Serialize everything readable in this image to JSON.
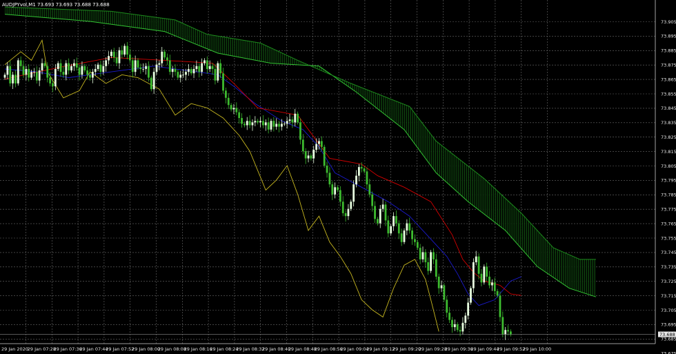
{
  "window": {
    "symbol_info": "AUDJPYvol,M1  73.693 73.693 73.688 73.688"
  },
  "chart_data": {
    "type": "candlestick",
    "title": "AUDJPYvol,M1",
    "ohlc_header": {
      "open": 73.693,
      "high": 73.693,
      "low": 73.688,
      "close": 73.688
    },
    "current_price": 73.688,
    "ylim": [
      73.675,
      73.905
    ],
    "y_ticks": [
      "73.905",
      "73.895",
      "73.885",
      "73.875",
      "73.865",
      "73.855",
      "73.845",
      "73.835",
      "73.825",
      "73.815",
      "73.805",
      "73.795",
      "73.785",
      "73.775",
      "73.765",
      "73.755",
      "73.745",
      "73.735",
      "73.725",
      "73.715",
      "73.705",
      "73.695",
      "73.685",
      "73.675"
    ],
    "x_ticks": [
      "29 Jan 2020",
      "29 Jan 07:28",
      "29 Jan 07:36",
      "29 Jan 07:44",
      "29 Jan 07:52",
      "29 Jan 08:00",
      "29 Jan 08:08",
      "29 Jan 08:16",
      "29 Jan 08:24",
      "29 Jan 08:32",
      "29 Jan 08:40",
      "29 Jan 08:48",
      "29 Jan 08:56",
      "29 Jan 09:04",
      "29 Jan 09:12",
      "29 Jan 09:20",
      "29 Jan 09:28",
      "29 Jan 09:36",
      "29 Jan 09:44",
      "29 Jan 09:52",
      "29 Jan 10:00"
    ],
    "grid": true,
    "colors": {
      "background": "#000000",
      "grid": "#6b6b6b",
      "bull": "#e8ffe0",
      "bear": "#3dbb2f",
      "tenkan": "#d40000",
      "kijun": "#1a1acc",
      "chikou": "#c8b820",
      "senkou_a": "#33c433",
      "senkou_b": "#1d8a1d",
      "cloud": "#1a7a1a"
    },
    "close_series": [
      73.868,
      73.874,
      73.862,
      73.868,
      73.862,
      73.878,
      73.874,
      73.868,
      73.872,
      73.866,
      73.87,
      73.87,
      73.864,
      73.871,
      73.876,
      73.874,
      73.866,
      73.862,
      73.86,
      73.872,
      73.876,
      73.87,
      73.868,
      73.876,
      73.871,
      73.874,
      73.876,
      73.873,
      73.868,
      73.874,
      73.871,
      73.868,
      73.866,
      73.87,
      73.872,
      73.875,
      73.87,
      73.874,
      73.878,
      73.881,
      73.884,
      73.88,
      73.876,
      73.885,
      73.882,
      73.888,
      73.882,
      73.878,
      73.87,
      73.878,
      73.873,
      73.872,
      73.872,
      73.874,
      73.866,
      73.858,
      73.87,
      73.875,
      73.876,
      73.884,
      73.88,
      73.878,
      73.87,
      73.872,
      73.87,
      73.866,
      73.868,
      73.868,
      73.87,
      73.872,
      73.869,
      73.872,
      73.874,
      73.87,
      73.876,
      73.878,
      73.872,
      73.874,
      73.872,
      73.864,
      73.876,
      73.869,
      73.857,
      73.852,
      73.847,
      73.844,
      73.845,
      73.842,
      73.838,
      73.834,
      73.833,
      73.836,
      73.833,
      73.835,
      73.836,
      73.835,
      73.836,
      73.833,
      73.835,
      73.83,
      73.836,
      73.832,
      73.834,
      73.832,
      73.834,
      73.834,
      73.836,
      73.837,
      73.835,
      73.841,
      73.835,
      73.823,
      73.815,
      73.81,
      73.812,
      73.81,
      73.816,
      73.82,
      73.822,
      73.818,
      73.805,
      73.8,
      73.792,
      73.785,
      73.79,
      73.788,
      73.78,
      73.772,
      73.77,
      73.775,
      73.78,
      73.792,
      73.798,
      73.804,
      73.803,
      73.801,
      73.792,
      73.785,
      73.777,
      73.768,
      73.765,
      73.775,
      73.778,
      73.767,
      73.758,
      73.763,
      73.77,
      73.765,
      73.758,
      73.752,
      73.76,
      73.765,
      73.76,
      73.754,
      73.752,
      73.748,
      73.74,
      73.745,
      73.738,
      73.732,
      73.745,
      73.74,
      73.728,
      73.72,
      73.722,
      73.712,
      73.703,
      73.698,
      73.693,
      73.695,
      73.691,
      73.69,
      73.696,
      73.701,
      73.71,
      73.72,
      73.738,
      73.742,
      73.73,
      73.724,
      73.735,
      73.728,
      73.722,
      73.724,
      73.718,
      73.715,
      73.7,
      73.688,
      73.691,
      73.69,
      73.688
    ],
    "tenkan_sen": [
      [
        0,
        73.865
      ],
      [
        20,
        73.873
      ],
      [
        40,
        73.88
      ],
      [
        60,
        73.878
      ],
      [
        78,
        73.876
      ],
      [
        86,
        73.862
      ],
      [
        95,
        73.845
      ],
      [
        110,
        73.84
      ],
      [
        116,
        73.825
      ],
      [
        122,
        73.81
      ],
      [
        134,
        73.806
      ],
      [
        140,
        73.798
      ],
      [
        150,
        73.79
      ],
      [
        160,
        73.78
      ],
      [
        168,
        73.757
      ],
      [
        172,
        73.74
      ],
      [
        176,
        73.731
      ],
      [
        180,
        73.725
      ],
      [
        186,
        73.722
      ],
      [
        190,
        73.716
      ],
      [
        194,
        73.715
      ]
    ],
    "kijun_sen": [
      [
        0,
        73.872
      ],
      [
        12,
        73.87
      ],
      [
        24,
        73.866
      ],
      [
        40,
        73.87
      ],
      [
        56,
        73.874
      ],
      [
        72,
        73.87
      ],
      [
        80,
        73.868
      ],
      [
        86,
        73.86
      ],
      [
        94,
        73.848
      ],
      [
        104,
        73.836
      ],
      [
        112,
        73.83
      ],
      [
        118,
        73.818
      ],
      [
        124,
        73.8
      ],
      [
        134,
        73.79
      ],
      [
        144,
        73.78
      ],
      [
        152,
        73.77
      ],
      [
        158,
        73.758
      ],
      [
        166,
        73.742
      ],
      [
        170,
        73.73
      ],
      [
        174,
        73.716
      ],
      [
        178,
        73.708
      ],
      [
        184,
        73.712
      ],
      [
        190,
        73.725
      ],
      [
        194,
        73.728
      ]
    ],
    "chikou_span": [
      [
        0,
        73.875
      ],
      [
        6,
        73.884
      ],
      [
        10,
        73.878
      ],
      [
        14,
        73.892
      ],
      [
        16,
        73.87
      ],
      [
        22,
        73.852
      ],
      [
        28,
        73.857
      ],
      [
        32,
        73.87
      ],
      [
        38,
        73.862
      ],
      [
        44,
        73.868
      ],
      [
        50,
        73.866
      ],
      [
        58,
        73.858
      ],
      [
        64,
        73.84
      ],
      [
        70,
        73.848
      ],
      [
        76,
        73.845
      ],
      [
        82,
        73.838
      ],
      [
        88,
        73.826
      ],
      [
        92,
        73.815
      ],
      [
        98,
        73.788
      ],
      [
        102,
        73.795
      ],
      [
        106,
        73.805
      ],
      [
        110,
        73.785
      ],
      [
        114,
        73.76
      ],
      [
        118,
        73.77
      ],
      [
        122,
        73.752
      ],
      [
        126,
        73.742
      ],
      [
        130,
        73.73
      ],
      [
        134,
        73.712
      ],
      [
        138,
        73.705
      ],
      [
        142,
        73.7
      ],
      [
        146,
        73.72
      ],
      [
        150,
        73.736
      ],
      [
        154,
        73.74
      ],
      [
        158,
        73.726
      ],
      [
        160,
        73.712
      ],
      [
        163,
        73.69
      ]
    ],
    "senkou_span_a": [
      [
        0,
        73.91
      ],
      [
        32,
        73.905
      ],
      [
        60,
        73.898
      ],
      [
        80,
        73.883
      ],
      [
        100,
        73.876
      ],
      [
        118,
        73.874
      ],
      [
        132,
        73.856
      ],
      [
        150,
        73.83
      ],
      [
        162,
        73.8
      ],
      [
        174,
        73.78
      ],
      [
        188,
        73.76
      ],
      [
        200,
        73.735
      ],
      [
        212,
        73.72
      ],
      [
        222,
        73.714
      ]
    ],
    "senkou_span_b": [
      [
        0,
        73.915
      ],
      [
        40,
        73.912
      ],
      [
        64,
        73.906
      ],
      [
        76,
        73.896
      ],
      [
        96,
        73.89
      ],
      [
        110,
        73.878
      ],
      [
        130,
        73.862
      ],
      [
        152,
        73.846
      ],
      [
        162,
        73.822
      ],
      [
        180,
        73.796
      ],
      [
        194,
        73.772
      ],
      [
        206,
        73.748
      ],
      [
        216,
        73.74
      ],
      [
        222,
        73.74
      ]
    ]
  }
}
